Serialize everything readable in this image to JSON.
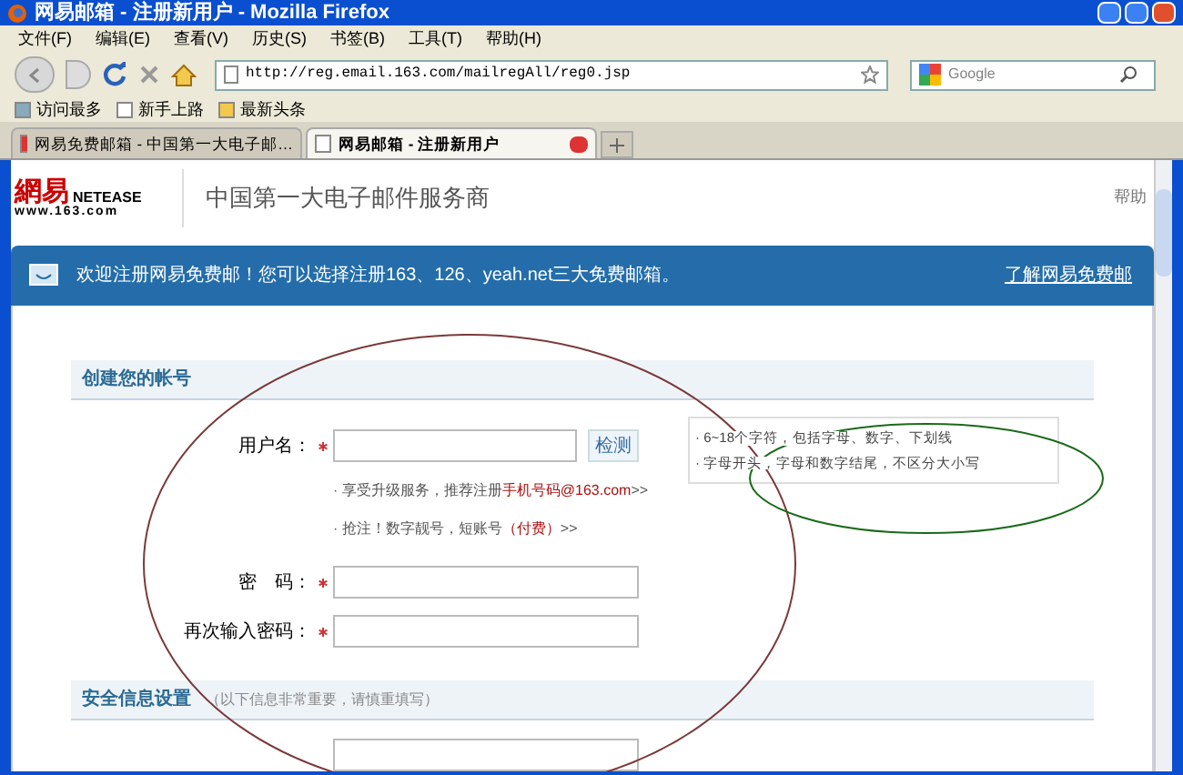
{
  "window": {
    "title": "网易邮箱 - 注册新用户 - Mozilla Firefox"
  },
  "menu": [
    "文件(F)",
    "编辑(E)",
    "查看(V)",
    "历史(S)",
    "书签(B)",
    "工具(T)",
    "帮助(H)"
  ],
  "address": {
    "value": "http://reg.email.163.com/mailregAll/reg0.jsp"
  },
  "search": {
    "placeholder": "Google"
  },
  "bookmarks": [
    "访问最多",
    "新手上路",
    "最新头条"
  ],
  "tabs": [
    {
      "label": "网易免费邮箱 - 中国第一大电子邮…",
      "selected": false
    },
    {
      "label": "网易邮箱 - 注册新用户",
      "selected": true
    }
  ],
  "page": {
    "logo": {
      "brand": "網易",
      "latin": "NETEASE",
      "domain": "www.163.com"
    },
    "slogan": "中国第一大电子邮件服务商",
    "help": "帮助",
    "banner": {
      "text": "欢迎注册网易免费邮！您可以选择注册163、126、yeah.net三大免费邮箱。",
      "link": "了解网易免费邮"
    },
    "sections": [
      {
        "title": "创建您的帐号"
      },
      {
        "title": "安全信息设置",
        "note": "（以下信息非常重要，请慎重填写）"
      }
    ],
    "fields": [
      {
        "label": "用户名：",
        "required": true,
        "button": "检测"
      },
      {
        "label": "密　码：",
        "required": true
      },
      {
        "label": "再次输入密码：",
        "required": true
      }
    ],
    "tips": [
      [
        {
          "kind": "plain",
          "text": "· 享受升级服务，推荐注册"
        },
        {
          "kind": "highlight",
          "text": "手机号码@163.com"
        },
        {
          "kind": "plain",
          "text": ">>"
        }
      ],
      [
        {
          "kind": "plain",
          "text": "· 抢注！数字靓号，短账号"
        },
        {
          "kind": "highlight",
          "text": "（付费）"
        },
        {
          "kind": "plain",
          "text": ">>"
        }
      ]
    ],
    "hint": [
      "· 6~18个字符，包括字母、数字、下划线",
      "· 字母开头，字母和数字结尾，不区分大小写"
    ]
  }
}
